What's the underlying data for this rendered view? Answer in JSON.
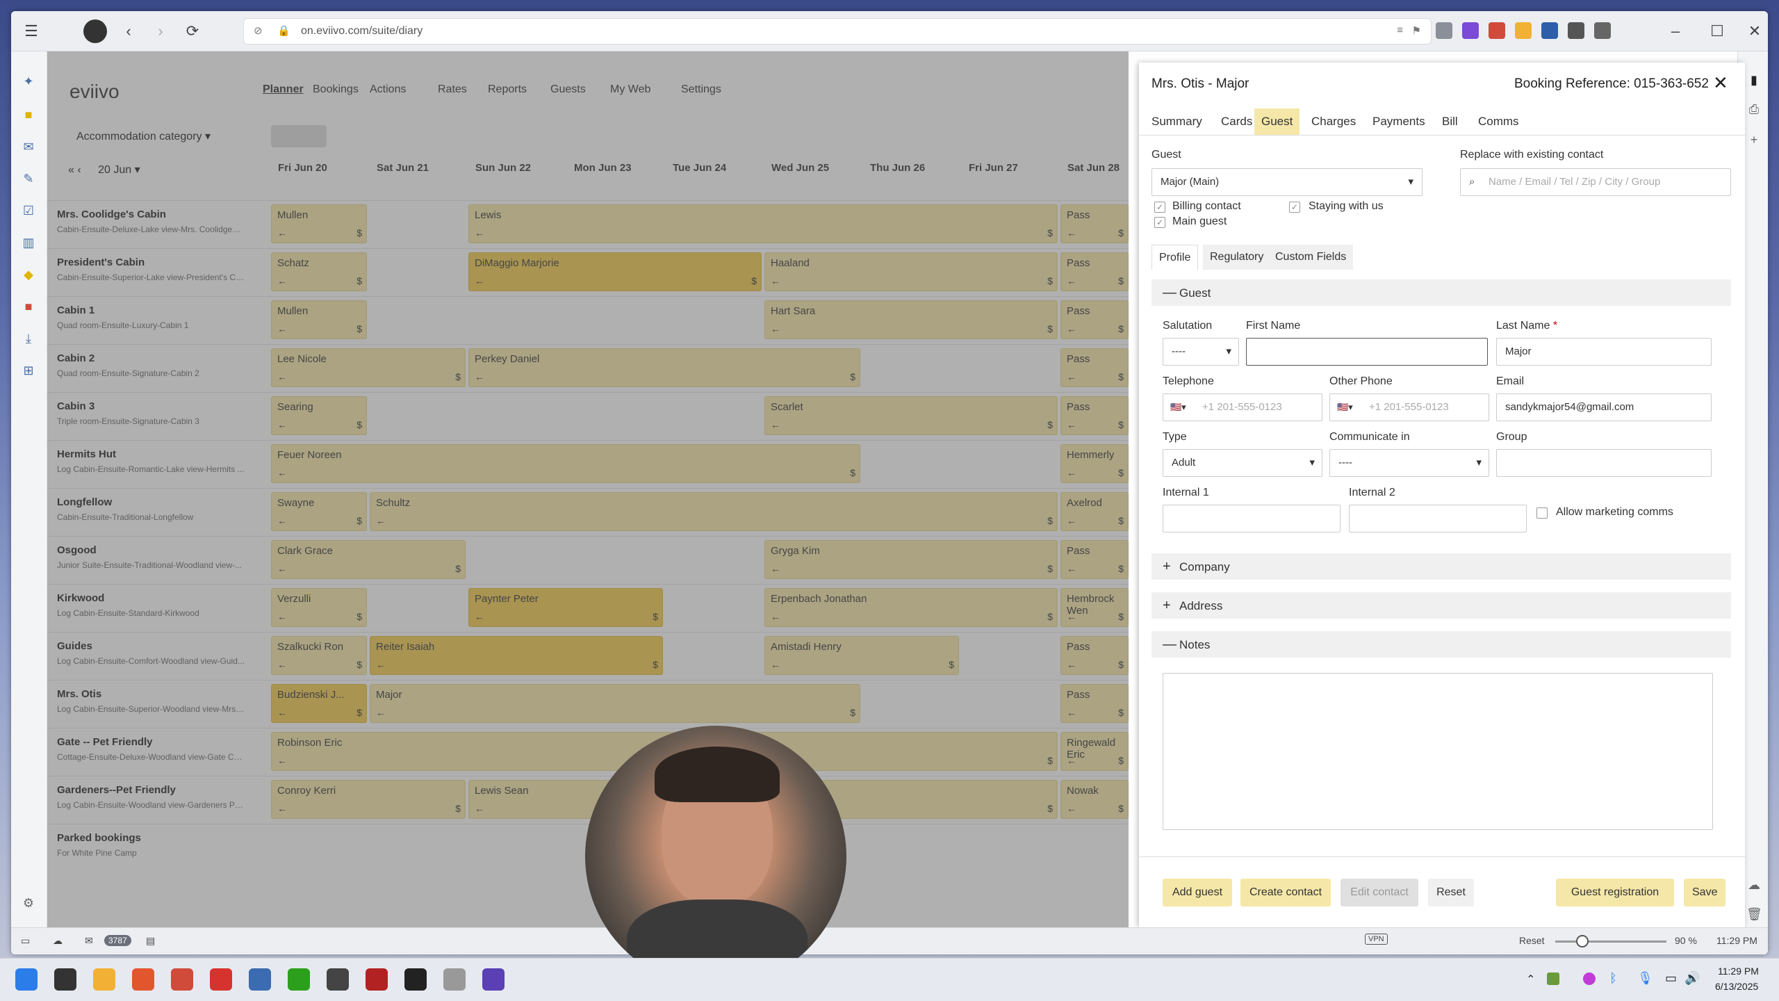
{
  "browser": {
    "url": "on.eviivo.com/suite/diary"
  },
  "app": {
    "logo": "eviivo",
    "nav": [
      "Planner",
      "Bookings",
      "Actions",
      "Rates",
      "Reports",
      "Guests",
      "My Web",
      "Settings"
    ],
    "category": "Accommodation category",
    "date": "20 Jun",
    "days": [
      "Fri Jun 20",
      "Sat Jun 21",
      "Sun Jun 22",
      "Mon Jun 23",
      "Tue Jun 24",
      "Wed Jun 25",
      "Thu Jun 26",
      "Fri Jun 27",
      "Sat Jun 28"
    ],
    "rooms": [
      {
        "name": "Mrs. Coolidge's Cabin",
        "desc": "Cabin-Ensuite-Deluxe-Lake view-Mrs. Coolidges ..."
      },
      {
        "name": "President's Cabin",
        "desc": "Cabin-Ensuite-Superior-Lake view-President's Ca..."
      },
      {
        "name": "Cabin 1",
        "desc": "Quad room-Ensuite-Luxury-Cabin 1"
      },
      {
        "name": "Cabin 2",
        "desc": "Quad room-Ensuite-Signature-Cabin 2"
      },
      {
        "name": "Cabin 3",
        "desc": "Triple room-Ensuite-Signature-Cabin 3"
      },
      {
        "name": "Hermits Hut",
        "desc": "Log Cabin-Ensuite-Romantic-Lake view-Hermits ..."
      },
      {
        "name": "Longfellow",
        "desc": "Cabin-Ensuite-Traditional-Longfellow"
      },
      {
        "name": "Osgood",
        "desc": "Junior Suite-Ensuite-Traditional-Woodland view-..."
      },
      {
        "name": "Kirkwood",
        "desc": "Log Cabin-Ensuite-Standard-Kirkwood"
      },
      {
        "name": "Guides",
        "desc": "Log Cabin-Ensuite-Comfort-Woodland view-Guid..."
      },
      {
        "name": "Mrs. Otis",
        "desc": "Log Cabin-Ensuite-Superior-Woodland view-Mrs ..."
      },
      {
        "name": "Gate -- Pet Friendly",
        "desc": "Cottage-Ensuite-Deluxe-Woodland view-Gate Cot..."
      },
      {
        "name": "Gardeners--Pet Friendly",
        "desc": "Log Cabin-Ensuite-Woodland view-Gardeners Pe..."
      },
      {
        "name": "Parked bookings",
        "desc": "For White Pine Camp"
      }
    ],
    "bookings": [
      {
        "row": 0,
        "c0": 0,
        "c1": 1,
        "name": "Mullen"
      },
      {
        "row": 0,
        "c0": 2,
        "c1": 8,
        "name": "Lewis"
      },
      {
        "row": 0,
        "c0": 8,
        "c1": 9,
        "name": "Pass"
      },
      {
        "row": 1,
        "c0": 0,
        "c1": 1,
        "name": "Schatz"
      },
      {
        "row": 1,
        "c0": 2,
        "c1": 5,
        "name": "DiMaggio Marjorie",
        "dark": true
      },
      {
        "row": 1,
        "c0": 5,
        "c1": 8,
        "name": "Haaland"
      },
      {
        "row": 1,
        "c0": 8,
        "c1": 9,
        "name": "Pass"
      },
      {
        "row": 2,
        "c0": 0,
        "c1": 1,
        "name": "Mullen"
      },
      {
        "row": 2,
        "c0": 5,
        "c1": 8,
        "name": "Hart Sara"
      },
      {
        "row": 2,
        "c0": 8,
        "c1": 9,
        "name": "Pass"
      },
      {
        "row": 3,
        "c0": 0,
        "c1": 2,
        "name": "Lee Nicole"
      },
      {
        "row": 3,
        "c0": 2,
        "c1": 6,
        "name": "Perkey Daniel"
      },
      {
        "row": 3,
        "c0": 8,
        "c1": 9,
        "name": "Pass"
      },
      {
        "row": 4,
        "c0": 0,
        "c1": 1,
        "name": "Searing"
      },
      {
        "row": 4,
        "c0": 5,
        "c1": 8,
        "name": "Scarlet"
      },
      {
        "row": 4,
        "c0": 8,
        "c1": 9,
        "name": "Pass"
      },
      {
        "row": 5,
        "c0": 0,
        "c1": 6,
        "name": "Feuer Noreen"
      },
      {
        "row": 5,
        "c0": 8,
        "c1": 9,
        "name": "Hemmerly"
      },
      {
        "row": 6,
        "c0": 0,
        "c1": 1,
        "name": "Swayne"
      },
      {
        "row": 6,
        "c0": 1,
        "c1": 8,
        "name": "Schultz"
      },
      {
        "row": 6,
        "c0": 8,
        "c1": 9,
        "name": "Axelrod"
      },
      {
        "row": 7,
        "c0": 0,
        "c1": 2,
        "name": "Clark Grace"
      },
      {
        "row": 7,
        "c0": 5,
        "c1": 8,
        "name": "Gryga Kim"
      },
      {
        "row": 7,
        "c0": 8,
        "c1": 9,
        "name": "Pass"
      },
      {
        "row": 8,
        "c0": 0,
        "c1": 1,
        "name": "Verzulli"
      },
      {
        "row": 8,
        "c0": 2,
        "c1": 4,
        "name": "Paynter Peter",
        "dark": true
      },
      {
        "row": 8,
        "c0": 5,
        "c1": 8,
        "name": "Erpenbach Jonathan"
      },
      {
        "row": 8,
        "c0": 8,
        "c1": 9,
        "name": "Hembrock Wen"
      },
      {
        "row": 9,
        "c0": 0,
        "c1": 1,
        "name": "Szalkucki Ron"
      },
      {
        "row": 9,
        "c0": 1,
        "c1": 4,
        "name": "Reiter Isaiah",
        "dark": true
      },
      {
        "row": 9,
        "c0": 5,
        "c1": 7,
        "name": "Amistadi Henry"
      },
      {
        "row": 9,
        "c0": 8,
        "c1": 9,
        "name": "Pass"
      },
      {
        "row": 10,
        "c0": 0,
        "c1": 1,
        "name": "Budzienski J...",
        "dark": true
      },
      {
        "row": 10,
        "c0": 1,
        "c1": 6,
        "name": "Major"
      },
      {
        "row": 10,
        "c0": 8,
        "c1": 9,
        "name": "Pass"
      },
      {
        "row": 11,
        "c0": 0,
        "c1": 8,
        "name": "Robinson Eric"
      },
      {
        "row": 11,
        "c0": 8,
        "c1": 9,
        "name": "Ringewald Eric"
      },
      {
        "row": 12,
        "c0": 0,
        "c1": 2,
        "name": "Conroy Kerri"
      },
      {
        "row": 12,
        "c0": 2,
        "c1": 8,
        "name": "Lewis Sean"
      },
      {
        "row": 12,
        "c0": 8,
        "c1": 9,
        "name": "Nowak"
      }
    ]
  },
  "panel": {
    "title": "Mrs. Otis - Major",
    "ref": "Booking Reference: 015-363-652",
    "tabs": [
      "Summary",
      "Cards",
      "Guest",
      "Charges",
      "Payments",
      "Bill",
      "Comms"
    ],
    "guest_label": "Guest",
    "guest_value": "Major (Main)",
    "replace_label": "Replace with existing contact",
    "replace_ph": "Name / Email / Tel / Zip / City / Group",
    "billing": "Billing contact",
    "staying": "Staying with us",
    "main": "Main guest",
    "subtabs": [
      "Profile",
      "Regulatory",
      "Custom Fields"
    ],
    "sect_guest": "Guest",
    "salutation": "Salutation",
    "salutation_val": "----",
    "first": "First Name",
    "last": "Last Name",
    "last_val": "Major",
    "tel": "Telephone",
    "tel_ph": "+1 201-555-0123",
    "other": "Other Phone",
    "other_ph": "+1 201-555-0123",
    "email": "Email",
    "email_val": "sandykmajor54@gmail.com",
    "type": "Type",
    "type_val": "Adult",
    "comm": "Communicate in",
    "comm_val": "----",
    "group": "Group",
    "int1": "Internal 1",
    "int2": "Internal 2",
    "marketing": "Allow marketing comms",
    "company": "Company",
    "address": "Address",
    "notes": "Notes",
    "btn_add": "Add guest",
    "btn_create": "Create contact",
    "btn_edit": "Edit contact",
    "btn_reset": "Reset",
    "btn_reg": "Guest registration",
    "btn_save": "Save"
  },
  "status": {
    "badge": "3787",
    "reset": "Reset",
    "zoom": "90 %",
    "time": "11:29 PM"
  },
  "taskbar": {
    "time": "11:29 PM",
    "date": "6/13/2025"
  }
}
